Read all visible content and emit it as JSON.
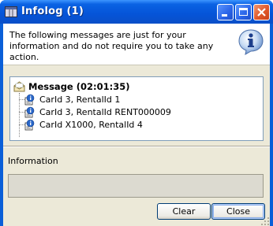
{
  "window": {
    "title": "Infolog (1)"
  },
  "header": {
    "message": "The following messages are just for your information and do not require you to take any action."
  },
  "tree": {
    "root_label": "Message (02:01:35)",
    "items": [
      {
        "label": "CarId 3, RentalId 1"
      },
      {
        "label": "CarId 3, RentalId RENT000009"
      },
      {
        "label": "CarId X1000, RentalId 4"
      }
    ]
  },
  "information": {
    "label": "Information",
    "value": ""
  },
  "buttons": {
    "clear": "Clear",
    "close": "Close"
  },
  "colors": {
    "titlebar": "#0554d8",
    "close_button": "#e0582a",
    "dialog_face": "#ece9d8"
  }
}
